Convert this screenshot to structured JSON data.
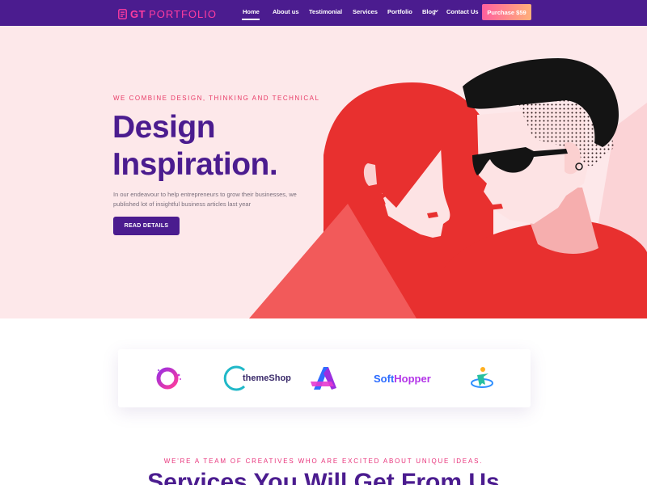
{
  "nav": {
    "logo_prefix": "GT",
    "logo_name": "PORTFOLIO",
    "items": [
      "Home",
      "About us",
      "Testimonial",
      "Services",
      "Portfolio",
      "Blog",
      "Contact Us"
    ],
    "purchase_label": "Purchase $59"
  },
  "hero": {
    "tagline": "WE COMBINE DESIGN, THINKING AND TECHNICAL",
    "title": "Design\nInspiration.",
    "description": "In our endeavour to help entrepreneurs to grow their businesses, we published lot of insightful business articles last year",
    "button_label": "READ DETAILS"
  },
  "clients": {
    "themeshop": "themeShop",
    "softhopper_a": "Soft",
    "softhopper_b": "Hopper"
  },
  "services": {
    "tagline": "WE'RE A TEAM OF CREATIVES WHO ARE EXCITED ABOUT UNIQUE IDEAS.",
    "title": "Services You Will Get From Us"
  },
  "colors": {
    "nav_bg": "#4b1c8f",
    "accent_pink": "#ff3ca0",
    "hero_bg": "#fde8ea",
    "primary_purple": "#4b1c8f",
    "hero_red": "#e8302f"
  }
}
